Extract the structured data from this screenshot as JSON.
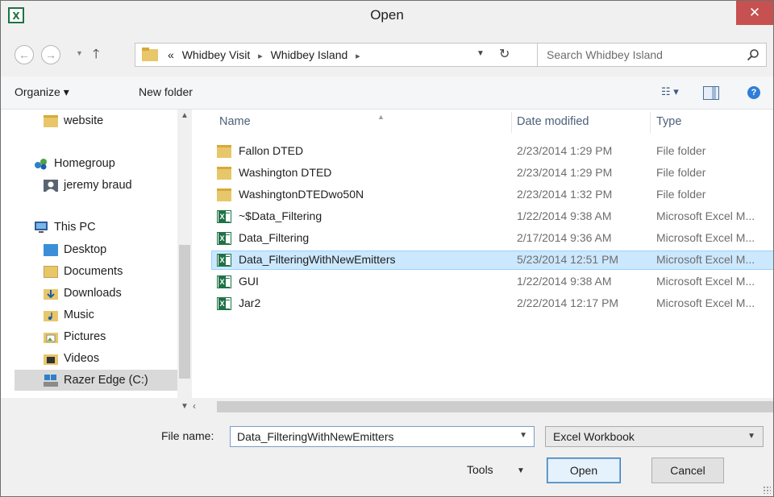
{
  "window": {
    "title": "Open",
    "close_label": "✕"
  },
  "address": {
    "prefix": "«",
    "crumbs": [
      "Whidbey Visit",
      "Whidbey Island"
    ],
    "separator": "▸"
  },
  "search": {
    "placeholder": "Search Whidbey Island"
  },
  "toolbar": {
    "organize_label": "Organize ▾",
    "new_folder_label": "New folder",
    "views_label": "☷ ▾",
    "help_label": "?"
  },
  "nav": {
    "items": [
      {
        "label": "website",
        "icon": "folder-icon"
      },
      {
        "label": "Homegroup",
        "icon": "homegroup-icon"
      },
      {
        "label": "jeremy braud",
        "icon": "user-icon"
      },
      {
        "label": "This PC",
        "icon": "computer-icon"
      },
      {
        "label": "Desktop",
        "icon": "desktop-icon"
      },
      {
        "label": "Documents",
        "icon": "documents-icon"
      },
      {
        "label": "Downloads",
        "icon": "downloads-icon"
      },
      {
        "label": "Music",
        "icon": "music-icon"
      },
      {
        "label": "Pictures",
        "icon": "pictures-icon"
      },
      {
        "label": "Videos",
        "icon": "videos-icon"
      },
      {
        "label": "Razer Edge (C:)",
        "icon": "drive-icon"
      }
    ]
  },
  "filelist": {
    "columns": {
      "name": "Name",
      "date": "Date modified",
      "type": "Type"
    },
    "rows": [
      {
        "name": "Fallon DTED",
        "date": "2/23/2014 1:29 PM",
        "type": "File folder",
        "icon": "folder"
      },
      {
        "name": "Washington DTED",
        "date": "2/23/2014 1:29 PM",
        "type": "File folder",
        "icon": "folder"
      },
      {
        "name": "WashingtonDTEDwo50N",
        "date": "2/23/2014 1:32 PM",
        "type": "File folder",
        "icon": "folder"
      },
      {
        "name": "~$Data_Filtering",
        "date": "1/22/2014 9:38 AM",
        "type": "Microsoft Excel M...",
        "icon": "excel"
      },
      {
        "name": "Data_Filtering",
        "date": "2/17/2014 9:36 AM",
        "type": "Microsoft Excel M...",
        "icon": "excel"
      },
      {
        "name": "Data_FilteringWithNewEmitters",
        "date": "5/23/2014 12:51 PM",
        "type": "Microsoft Excel M...",
        "icon": "excel",
        "selected": true
      },
      {
        "name": "GUI",
        "date": "1/22/2014 9:38 AM",
        "type": "Microsoft Excel M...",
        "icon": "excel"
      },
      {
        "name": "Jar2",
        "date": "2/22/2014 12:17 PM",
        "type": "Microsoft Excel M...",
        "icon": "excel"
      }
    ]
  },
  "bottom": {
    "file_name_label": "File name:",
    "file_name_value": "Data_FilteringWithNewEmitters",
    "file_type_value": "Excel Workbook",
    "tools_label": "Tools",
    "open_label": "Open",
    "cancel_label": "Cancel"
  },
  "colors": {
    "selected_row": "#cce8ff",
    "close_button": "#c75050",
    "column_header": "#4c607a"
  }
}
